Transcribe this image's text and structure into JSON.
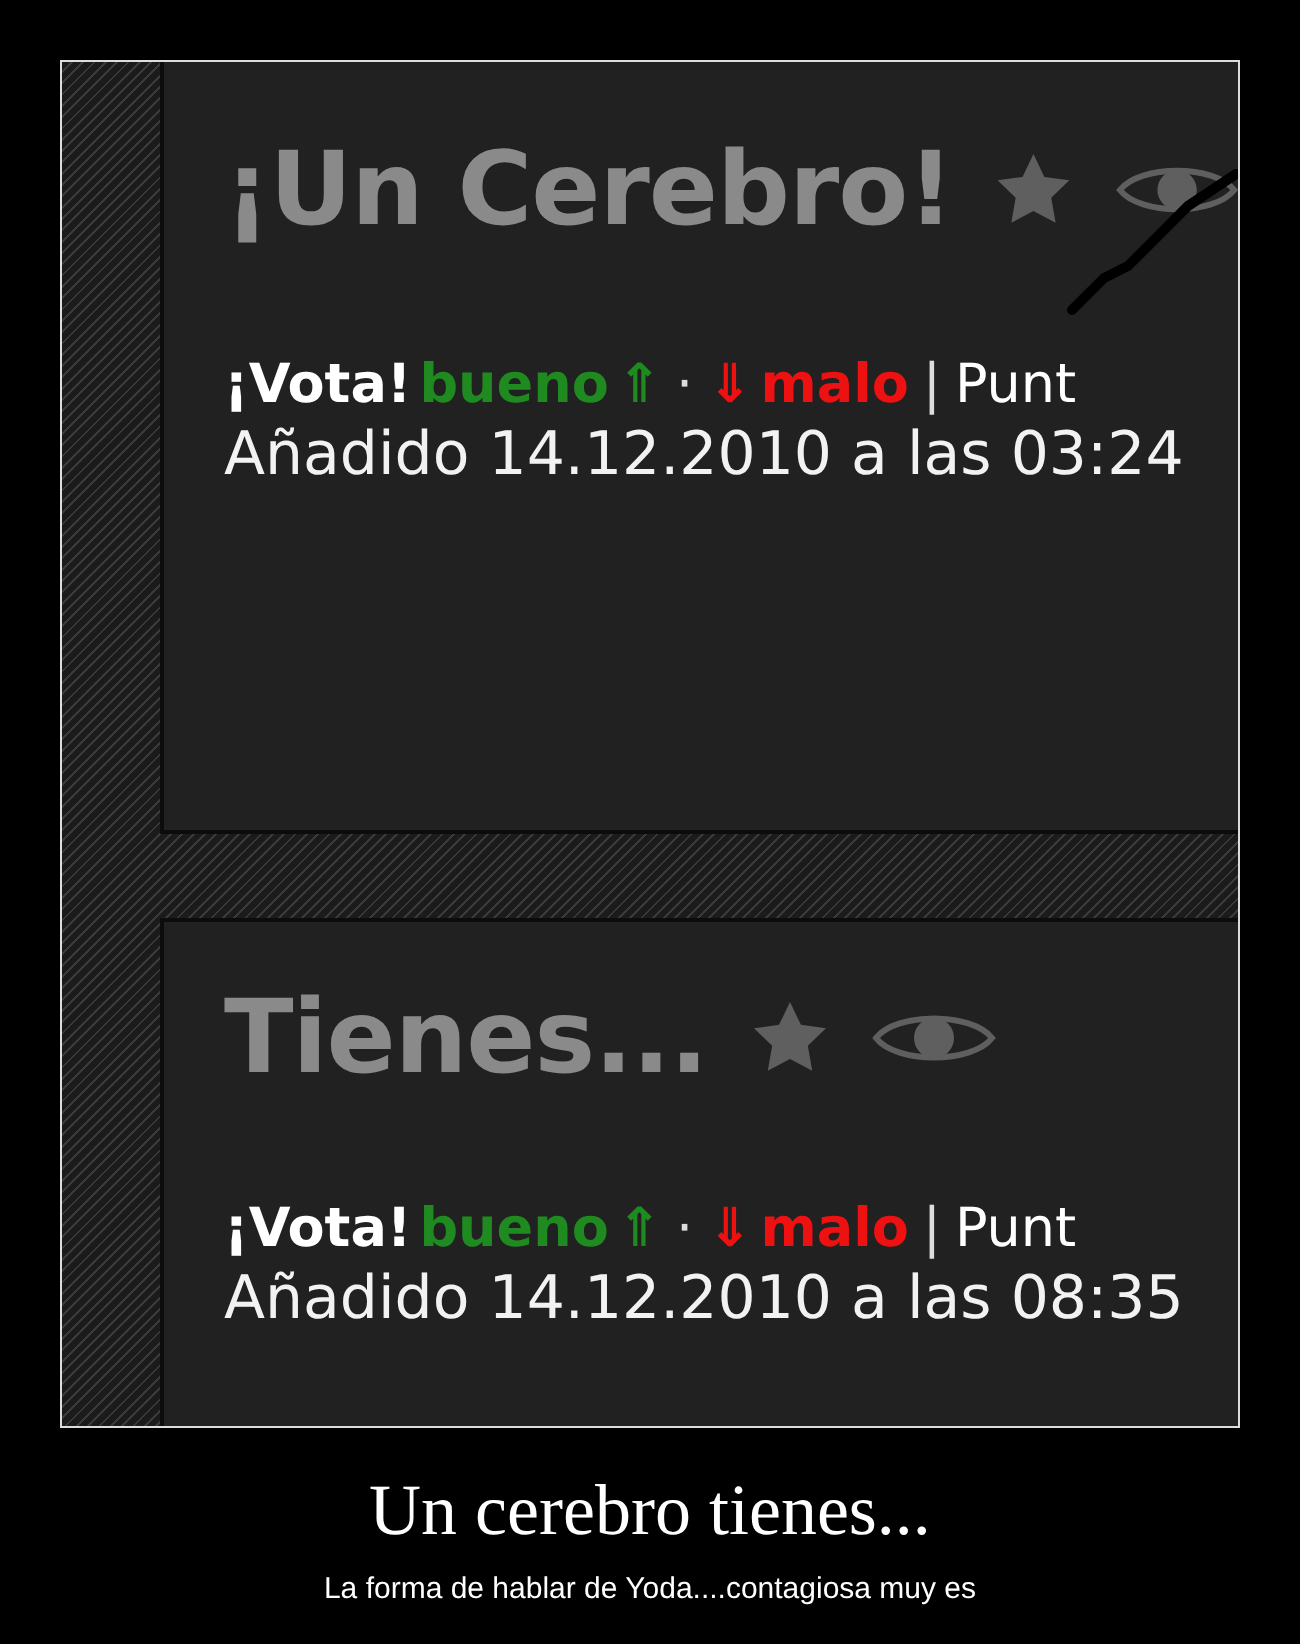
{
  "posts": [
    {
      "title": "¡Un Cerebro!",
      "scribbled": true,
      "vote": [
        {
          "kind": "label",
          "text": "¡Vota!"
        },
        {
          "kind": "good",
          "text": "bueno"
        },
        {
          "kind": "good",
          "text": "⇑"
        },
        {
          "kind": "sep",
          "text": "·"
        },
        {
          "kind": "bad",
          "text": "⇓"
        },
        {
          "kind": "bad",
          "text": "malo"
        },
        {
          "kind": "sep",
          "text": "|"
        },
        {
          "kind": "plain",
          "text": "Punt"
        }
      ],
      "added": "Añadido 14.12.2010 a las 03:24"
    },
    {
      "title": "Tienes...",
      "scribbled": false,
      "vote": [
        {
          "kind": "label",
          "text": "¡Vota!"
        },
        {
          "kind": "good",
          "text": "bueno"
        },
        {
          "kind": "good",
          "text": "⇑"
        },
        {
          "kind": "sep",
          "text": "·"
        },
        {
          "kind": "bad",
          "text": "⇓"
        },
        {
          "kind": "bad",
          "text": "malo"
        },
        {
          "kind": "sep",
          "text": "|"
        },
        {
          "kind": "plain",
          "text": "Punt"
        }
      ],
      "added": "Añadido 14.12.2010 a las 08:35"
    }
  ],
  "caption": {
    "title": "Un cerebro tienes...",
    "subtitle": "La forma de hablar de Yoda....contagiosa muy es"
  }
}
